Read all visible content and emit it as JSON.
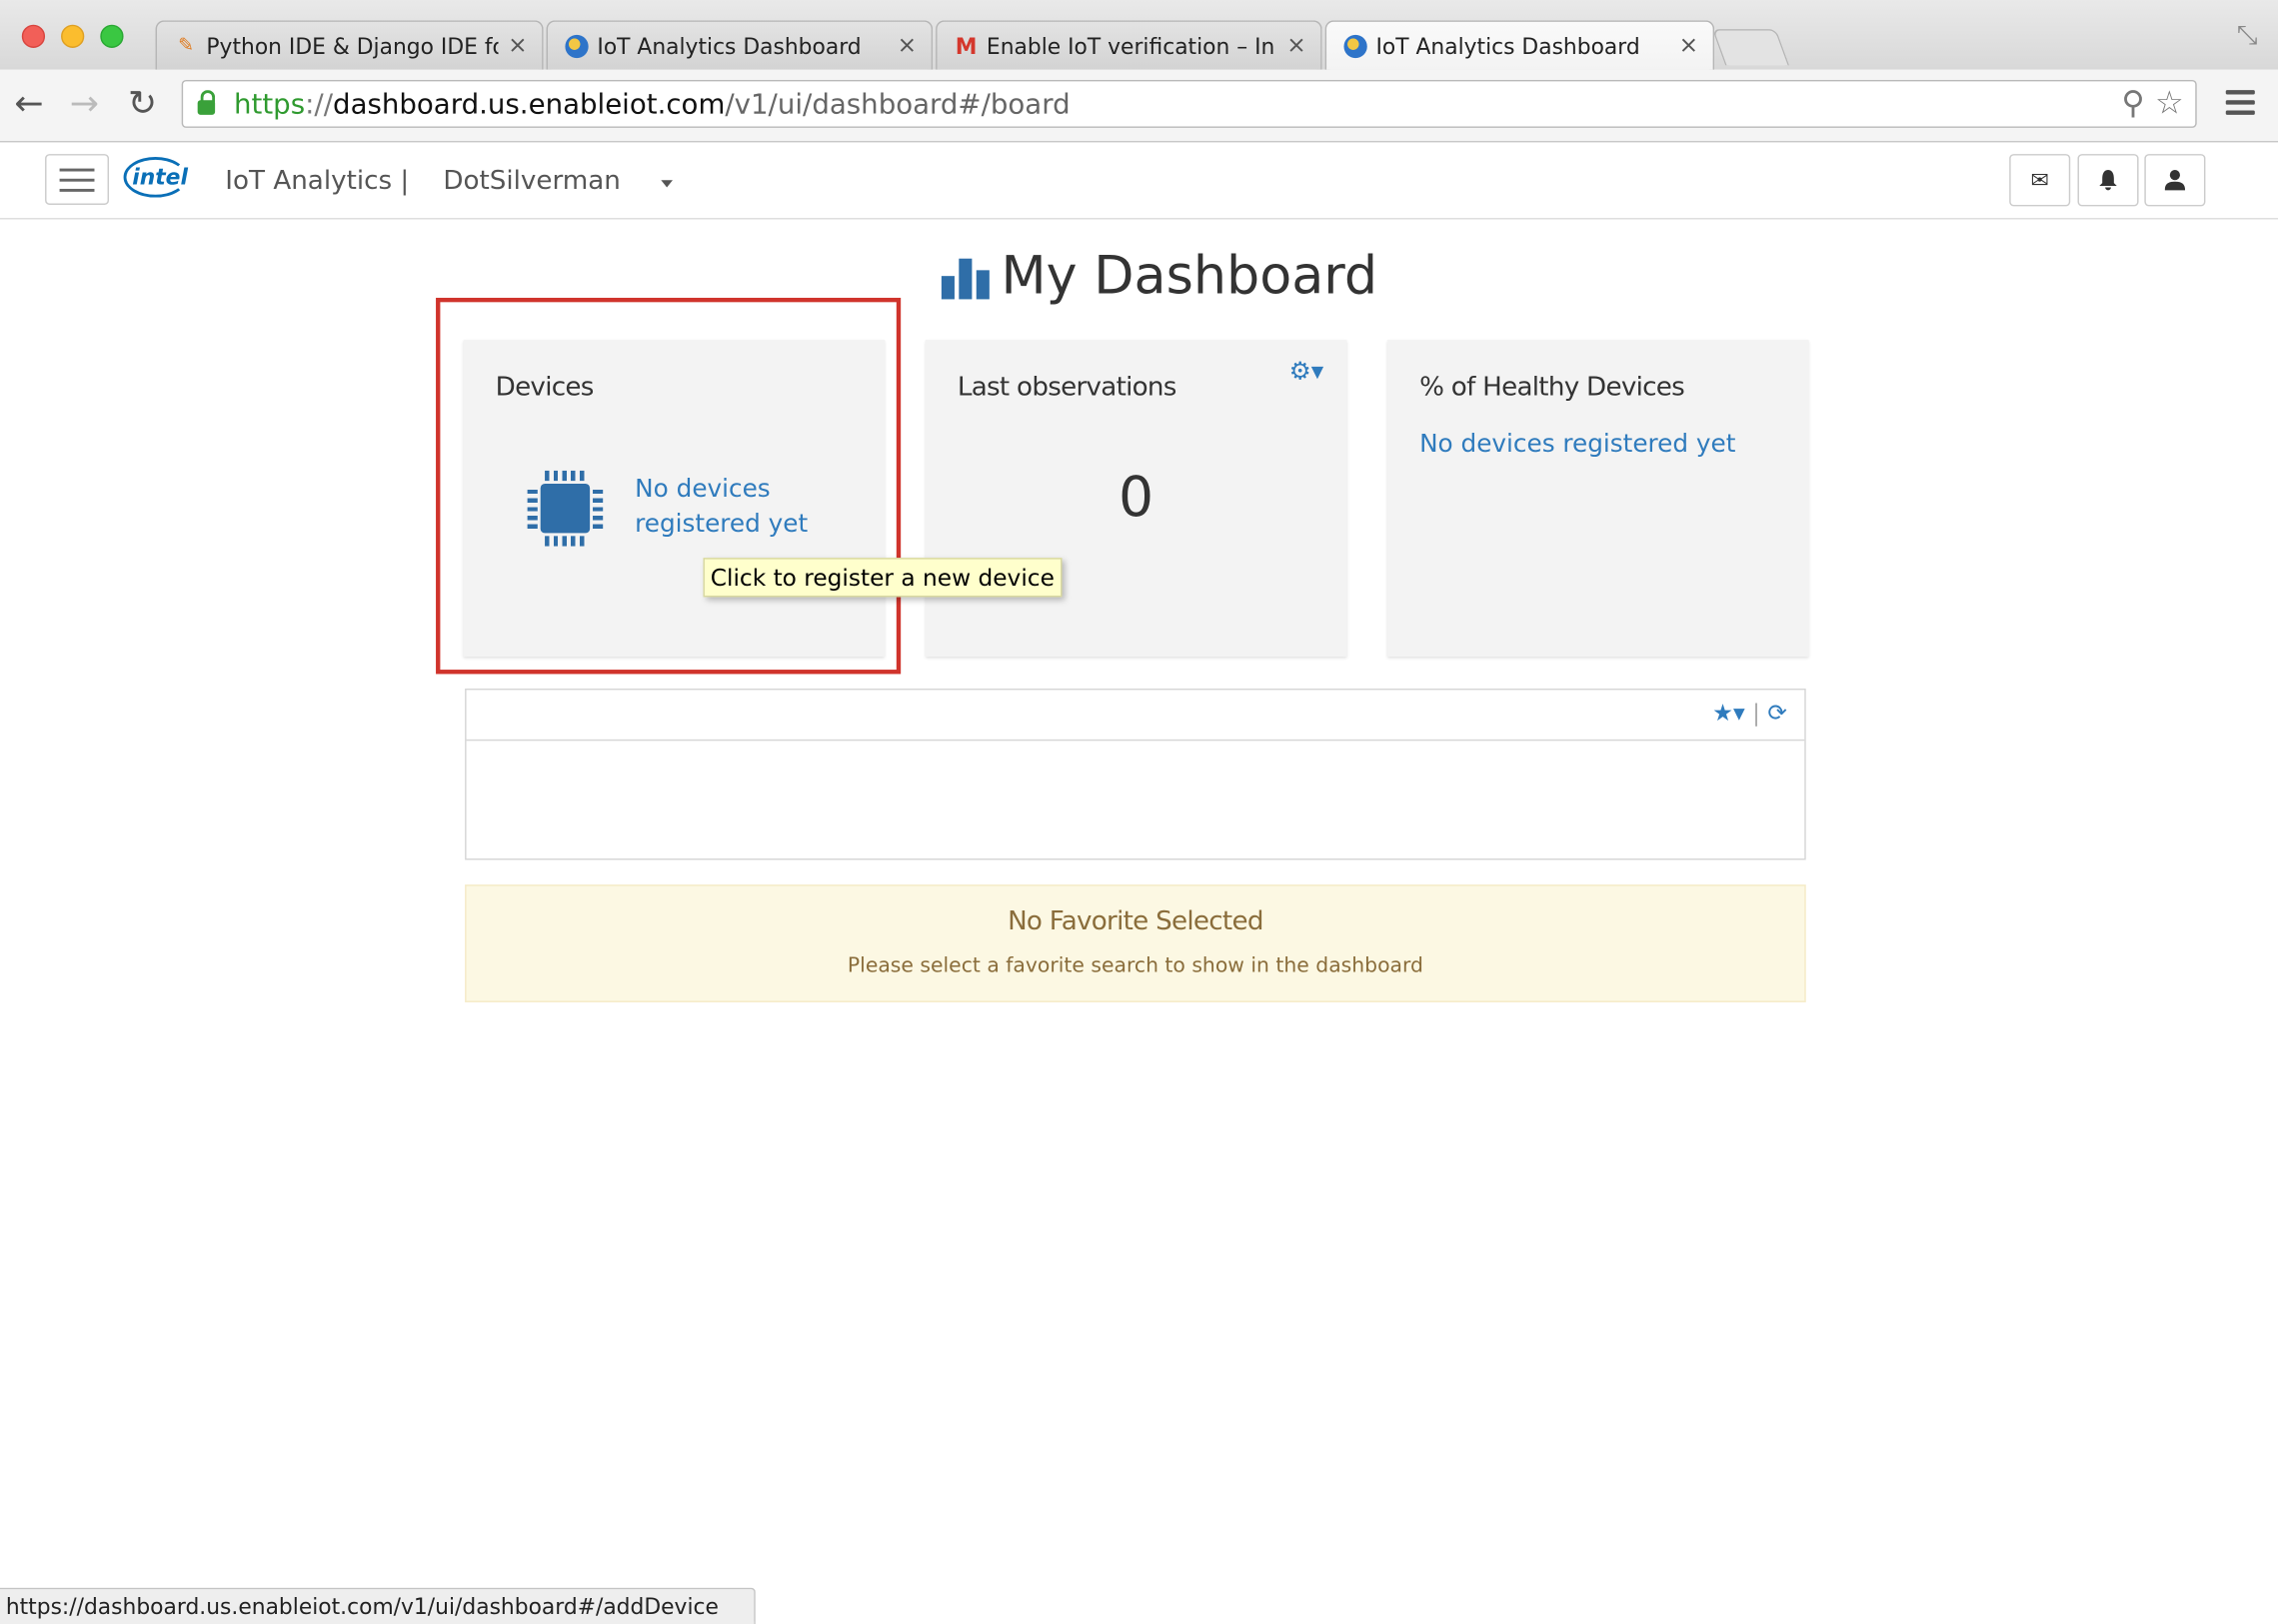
{
  "browser": {
    "tabs": [
      {
        "title": "Python IDE & Django IDE fo",
        "icon": "pycharm-icon"
      },
      {
        "title": "IoT Analytics Dashboard",
        "icon": "globe-icon"
      },
      {
        "title": "Enable IoT verification – In",
        "icon": "gmail-icon"
      },
      {
        "title": "IoT Analytics Dashboard",
        "icon": "globe-icon",
        "active": true
      }
    ],
    "close_glyph": "×",
    "url": {
      "scheme": "https",
      "sep": "://",
      "host": "dashboard.us.enableiot.com",
      "path": "/v1/ui/dashboard#/board"
    },
    "status_url": "https://dashboard.us.enableiot.com/v1/ui/dashboard#/addDevice"
  },
  "header": {
    "logo_text": "intel",
    "brand": "IoT Analytics |",
    "account": "DotSilverman",
    "icons": [
      "mail-icon",
      "bell-icon",
      "user-icon"
    ]
  },
  "page": {
    "title": "My Dashboard"
  },
  "cards": {
    "devices": {
      "title": "Devices",
      "message": "No devices registered yet",
      "tooltip": "Click to register a new device"
    },
    "observations": {
      "title": "Last observations",
      "value": "0"
    },
    "healthy": {
      "title": "% of Healthy Devices",
      "message": "No devices registered yet"
    }
  },
  "favorites": {
    "alert_title": "No Favorite Selected",
    "alert_text": "Please select a favorite search to show in the dashboard"
  },
  "colors": {
    "accent": "#2f7bbd",
    "brand_blue": "#2f6ea8",
    "highlight": "#d0342c",
    "alert_bg": "#fcf8e3",
    "alert_text": "#8a6d3b"
  }
}
